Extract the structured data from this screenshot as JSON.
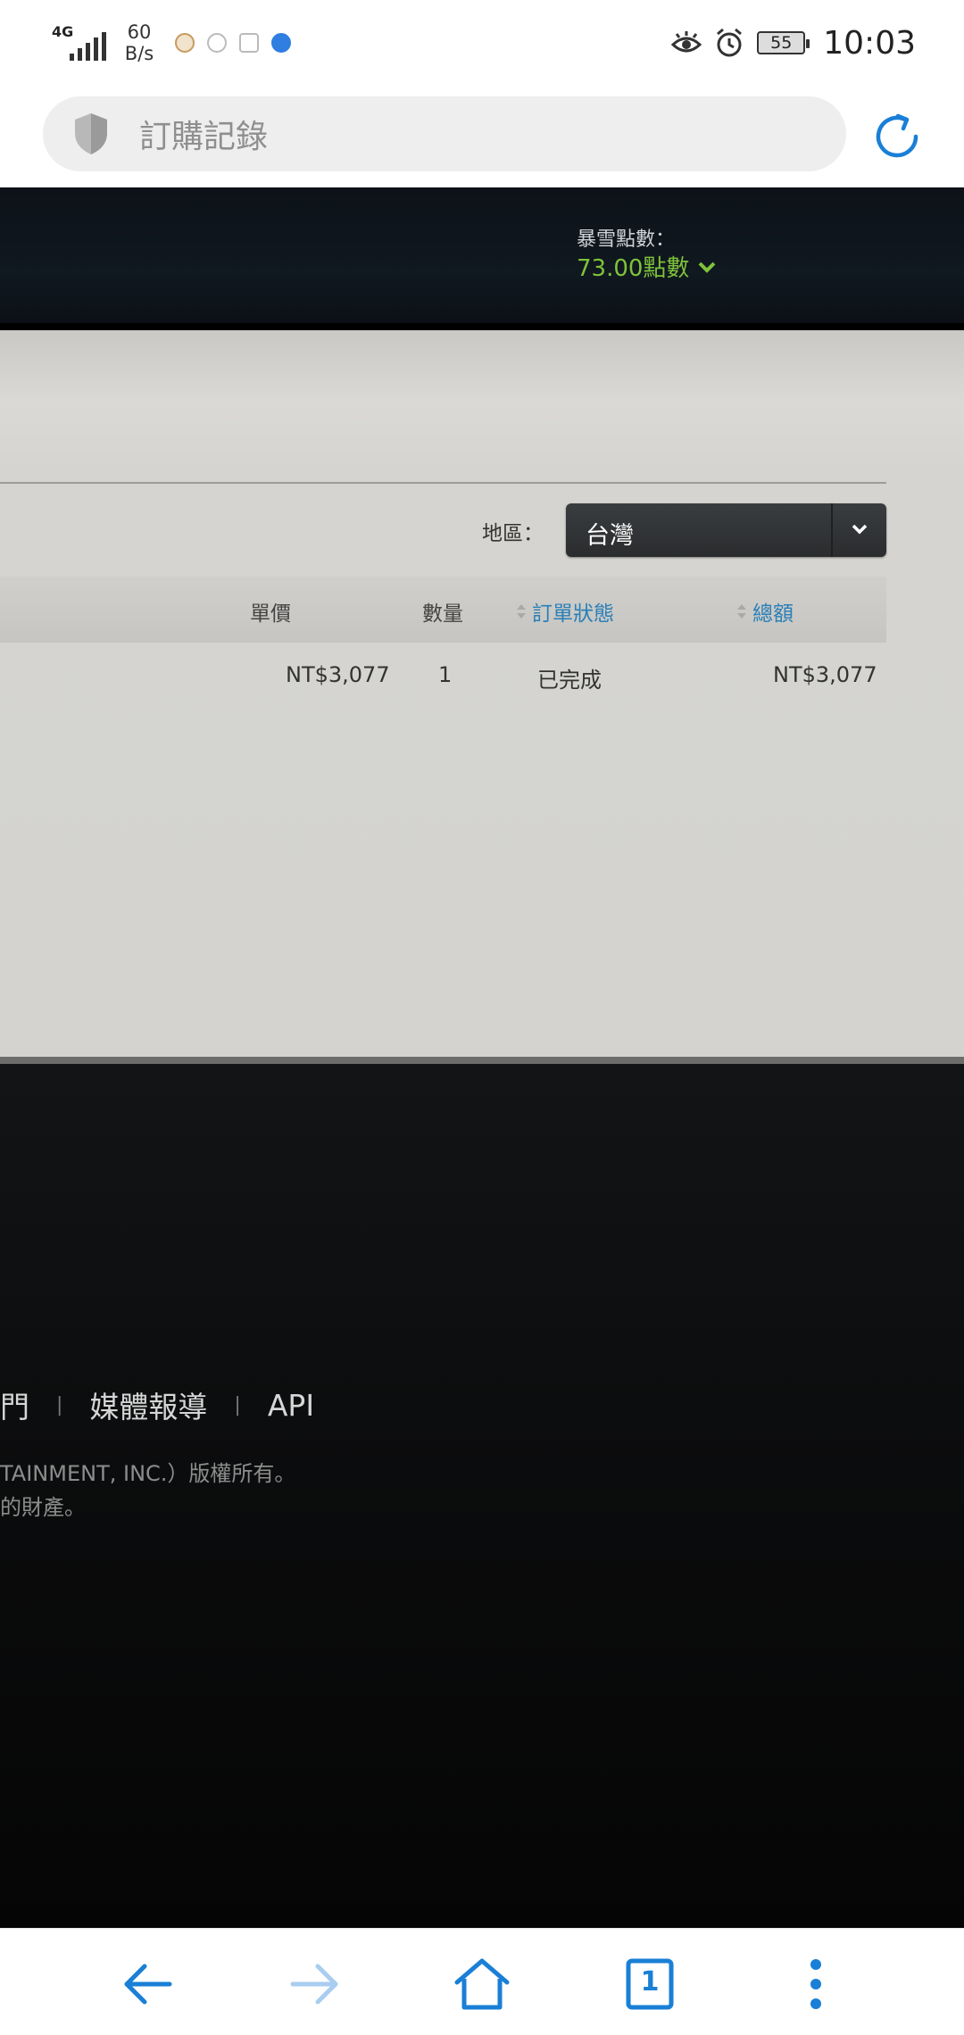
{
  "status_bar": {
    "network": "4G",
    "speed_value": "60",
    "speed_unit": "B/s",
    "battery": "55",
    "time": "10:03"
  },
  "url_bar": {
    "title": "訂購記錄"
  },
  "header": {
    "points_label": "暴雪點數：",
    "points_value": "73.00點數"
  },
  "filter": {
    "region_label": "地區：",
    "region_value": "台灣"
  },
  "table": {
    "headers": {
      "unit_price": "單價",
      "quantity": "數量",
      "order_status": "訂單狀態",
      "total": "總額"
    },
    "rows": [
      {
        "unit_price": "NT$3,077",
        "quantity": "1",
        "order_status": "已完成",
        "total": "NT$3,077"
      }
    ]
  },
  "footer": {
    "links": [
      "門",
      "媒體報導",
      "API"
    ],
    "separator": "|",
    "copyright_line1": "TAINMENT, INC.）版權所有。",
    "copyright_line2": "的財產。"
  },
  "colors": {
    "accent_blue": "#1a7fd6",
    "points_green": "#7fc23a",
    "link_blue": "#2a7fb8"
  },
  "icons": {
    "shield": "shield-icon",
    "reload": "reload-icon",
    "back": "back-arrow-icon",
    "forward": "forward-arrow-icon",
    "home": "home-icon",
    "tabs": "tabs-icon",
    "menu": "more-vertical-icon"
  },
  "bottom_nav": {
    "tab_count": "1"
  }
}
